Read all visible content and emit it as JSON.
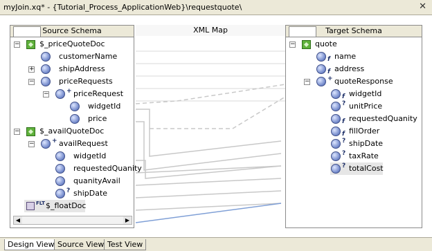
{
  "window": {
    "title": "myJoin.xq* - {Tutorial_Process_ApplicationWeb}\\requestquote\\",
    "close_icon": "close-icon"
  },
  "source": {
    "header": "Source Schema",
    "items": [
      {
        "label": "$_priceQuoteDoc"
      },
      {
        "label": "customerName"
      },
      {
        "label": "shipAddress"
      },
      {
        "label": "priceRequests"
      },
      {
        "label": "priceRequest",
        "mark": "+"
      },
      {
        "label": "widgetId"
      },
      {
        "label": "price"
      },
      {
        "label": "$_availQuoteDoc"
      },
      {
        "label": "availRequest",
        "mark": "+"
      },
      {
        "label": "widgetId"
      },
      {
        "label": "requestedQuanity"
      },
      {
        "label": "quanityAvail"
      },
      {
        "label": "shipDate",
        "mark": "?"
      },
      {
        "label": "$_floatDoc",
        "badge": "FLT"
      }
    ]
  },
  "map": {
    "header": "XML Map"
  },
  "target": {
    "header": "Target Schema",
    "items": [
      {
        "label": "quote"
      },
      {
        "label": "name",
        "mark": "f"
      },
      {
        "label": "address",
        "mark": "f"
      },
      {
        "label": "quoteResponse",
        "mark": "+"
      },
      {
        "label": "widgetId",
        "mark": "f"
      },
      {
        "label": "unitPrice",
        "mark": "?"
      },
      {
        "label": "requestedQuanity",
        "mark": "f"
      },
      {
        "label": "fillOrder",
        "mark": "f"
      },
      {
        "label": "shipDate",
        "mark": "?"
      },
      {
        "label": "taxRate",
        "mark": "?"
      },
      {
        "label": "totalCost",
        "mark": "?"
      }
    ]
  },
  "bottom_tabs": [
    "Design View",
    "Source View",
    "Test View"
  ],
  "colors": {
    "chrome": "#ece9d8",
    "selected_row": "#e6e6e6",
    "link_gray": "#c8c8c8",
    "link_blue": "#7f9fd6"
  }
}
